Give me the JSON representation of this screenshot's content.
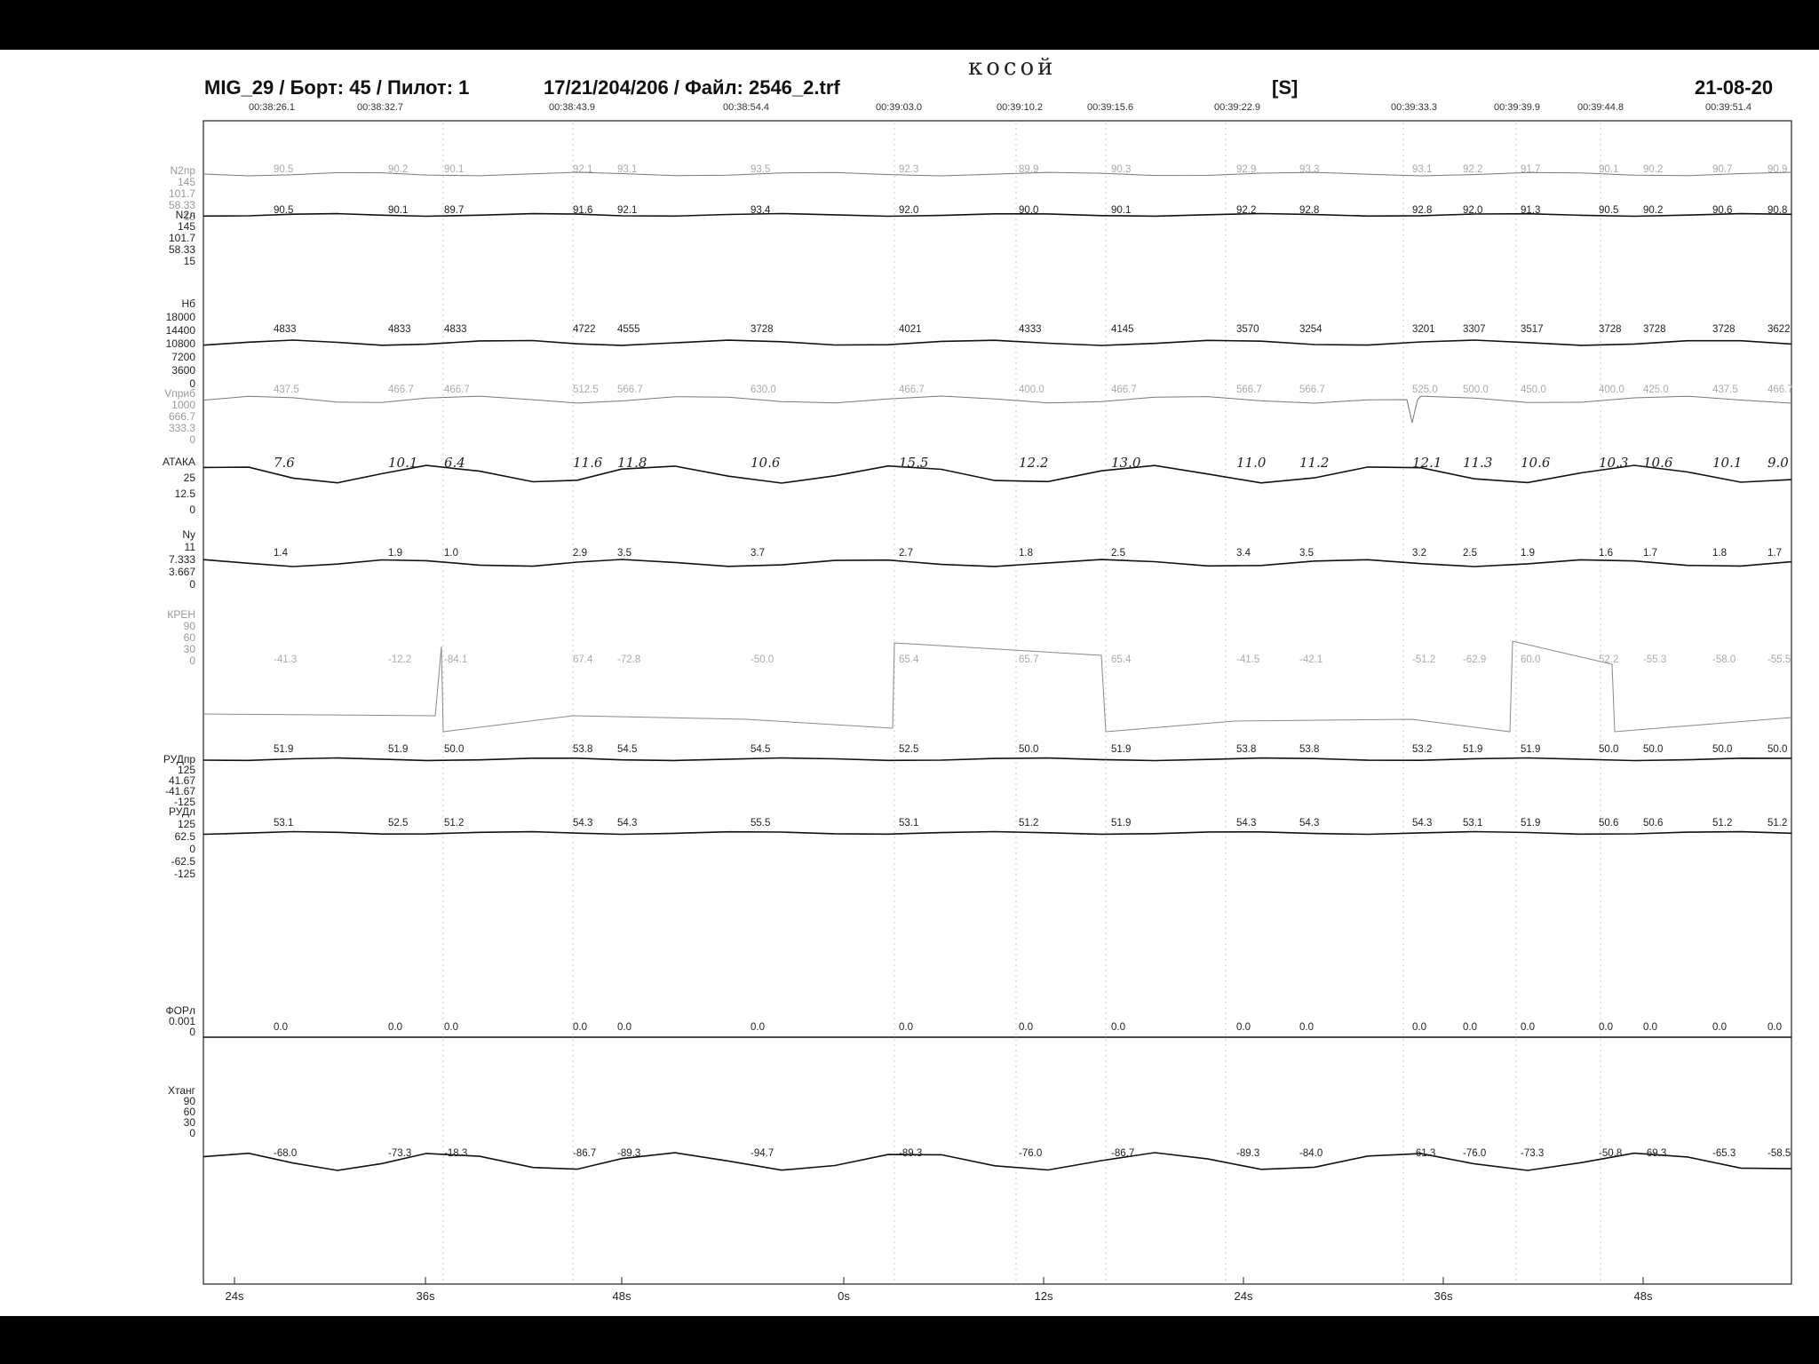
{
  "header": {
    "aircraft": "MIG_29 / Борт: 45 / Пилот: 1",
    "file": "17/21/204/206 / Файл: 2546_2.trf",
    "mode": "[S]",
    "date": "21-08-20",
    "handwritten_note": "косой"
  },
  "time_stamps": [
    "00:38:26.1",
    "00:38:32.7",
    "00:38:43.9",
    "00:38:54.4",
    "00:39:03.0",
    "00:39:10.2",
    "00:39:15.6",
    "00:39:22.9",
    "00:39:33.3",
    "00:39:39.9",
    "00:39:44.8",
    "00:39:51.4"
  ],
  "chart_data": {
    "type": "line",
    "x_axis": {
      "ticks": [
        "24s",
        "36s",
        "48s",
        "0s",
        "12s",
        "24s",
        "36s",
        "48s"
      ]
    },
    "tracks": [
      {
        "id": "N2pr",
        "label": "N2пр",
        "scale": [
          "145",
          "101.7",
          "58.33",
          "15"
        ],
        "faint": true,
        "annotations": [
          "90.5",
          "90.2",
          "90.1",
          "92.1",
          "93.1",
          "93.5",
          "92.3",
          "89.9",
          "90.3",
          "92.9",
          "93.3",
          "93.1",
          "92.2",
          "91.7",
          "90.1",
          "90.2",
          "90.7",
          "90.9"
        ]
      },
      {
        "id": "N2l",
        "label": "N2л",
        "scale": [
          "145",
          "101.7",
          "58.33",
          "15"
        ],
        "annotations": [
          "90.5",
          "90.1",
          "89.7",
          "91.6",
          "92.1",
          "93.4",
          "92.0",
          "90.0",
          "90.1",
          "92.2",
          "92.8",
          "92.8",
          "92.0",
          "91.3",
          "90.5",
          "90.2",
          "90.6",
          "90.8"
        ]
      },
      {
        "id": "H6",
        "label": "Нб",
        "scale": [
          "18000",
          "14400",
          "10800",
          "7200",
          "3600",
          "0"
        ],
        "annotations": [
          "4833",
          "4833",
          "4833",
          "4722",
          "4555",
          "3728",
          "4021",
          "4333",
          "4145",
          "3570",
          "3254",
          "3201",
          "3307",
          "3517",
          "3728",
          "3728",
          "3728",
          "3622"
        ]
      },
      {
        "id": "Vprib",
        "label": "Vприб",
        "scale": [
          "1000",
          "666.7",
          "333.3",
          "0"
        ],
        "faint": true,
        "annotations": [
          "437.5",
          "466.7",
          "466.7",
          "512.5",
          "566.7",
          "630.0",
          "466.7",
          "400.0",
          "466.7",
          "566.7",
          "566.7",
          "525.0",
          "500.0",
          "450.0",
          "400.0",
          "425.0",
          "437.5",
          "466.7"
        ]
      },
      {
        "id": "ataka",
        "label": "АТАКА",
        "scale": [
          "25",
          "12.5",
          "0"
        ],
        "handwritten": true,
        "annotations": [
          "7.6",
          "10.1",
          "6.4",
          "11.6",
          "11.8",
          "10.6",
          "15.5",
          "12.2",
          "13.0",
          "11.0",
          "11.2",
          "12.1",
          "11.3",
          "10.6",
          "10.3",
          "10.6",
          "10.1",
          "9.0"
        ]
      },
      {
        "id": "Ny",
        "label": "Ny",
        "scale": [
          "11",
          "7.333",
          "3.667",
          "0"
        ],
        "annotations": [
          "1.4",
          "1.9",
          "1.0",
          "2.9",
          "3.5",
          "3.7",
          "2.7",
          "1.8",
          "2.5",
          "3.4",
          "3.5",
          "3.2",
          "2.5",
          "1.9",
          "1.6",
          "1.7",
          "1.8",
          "1.7"
        ]
      },
      {
        "id": "kren",
        "label": "КРЕН",
        "scale": [
          "90",
          "60",
          "30",
          "0"
        ],
        "faint": true,
        "annotations": [
          "-41.3",
          "-12.2",
          "-84.1",
          "67.4",
          "-72.8",
          "-50.0",
          "65.4",
          "65.7",
          "65.4",
          "-41.5",
          "-42.1",
          "-51.2",
          "-62.9",
          "60.0",
          "52.2",
          "-55.3",
          "-58.0",
          "-55.5"
        ]
      },
      {
        "id": "RUDpr",
        "label": "РУДпр",
        "scale": [
          "125",
          "41.67",
          "-41.67",
          "-125"
        ],
        "annotations": [
          "51.9",
          "51.9",
          "50.0",
          "53.8",
          "54.5",
          "54.5",
          "52.5",
          "50.0",
          "51.9",
          "53.8",
          "53.8",
          "53.2",
          "51.9",
          "51.9",
          "50.0",
          "50.0",
          "50.0",
          "50.0"
        ]
      },
      {
        "id": "RUDl",
        "label": "РУДл",
        "scale": [
          "125",
          "62.5",
          "0",
          "-62.5",
          "-125"
        ],
        "annotations": [
          "53.1",
          "52.5",
          "51.2",
          "54.3",
          "54.3",
          "55.5",
          "53.1",
          "51.2",
          "51.9",
          "54.3",
          "54.3",
          "54.3",
          "53.1",
          "51.9",
          "50.6",
          "50.6",
          "51.2",
          "51.2"
        ]
      },
      {
        "id": "FORl",
        "label": "ФОРл",
        "scale": [
          "0.001",
          "0"
        ],
        "annotations": [
          "0.0",
          "0.0",
          "0.0",
          "0.0",
          "0.0",
          "0.0",
          "0.0",
          "0.0",
          "0.0",
          "0.0",
          "0.0",
          "0.0",
          "0.0",
          "0.0",
          "0.0",
          "0.0",
          "0.0",
          "0.0"
        ]
      },
      {
        "id": "Xtang",
        "label": "Хтанг",
        "scale": [
          "90",
          "60",
          "30",
          "0"
        ],
        "annotations": [
          "-68.0",
          "-73.3",
          "-18.3",
          "-86.7",
          "-89.3",
          "-94.7",
          "-89.3",
          "-76.0",
          "-86.7",
          "-89.3",
          "-84.0",
          "-61.3",
          "-76.0",
          "-73.3",
          "-50.8",
          "-69.3",
          "-65.3",
          "-58.5"
        ]
      }
    ]
  }
}
